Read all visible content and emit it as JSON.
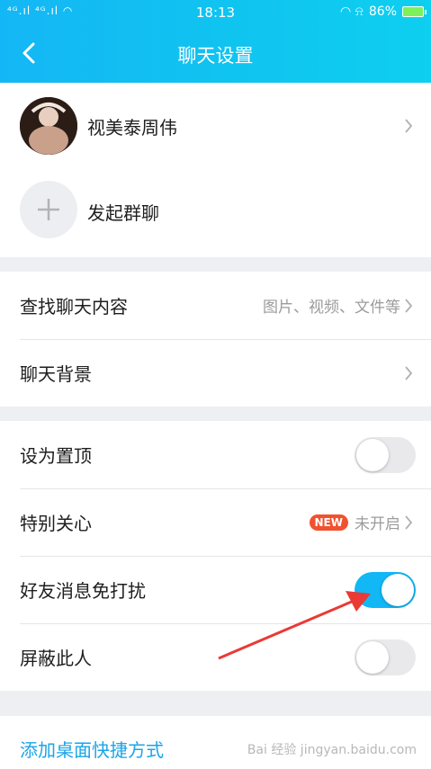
{
  "status_bar": {
    "signal_text": "⁴ᴳ.ıl ⁴ᴳ.ıl ◠",
    "time": "18:13",
    "icons_text": "◠ ⍾",
    "battery_percent": "86%"
  },
  "header": {
    "title": "聊天设置"
  },
  "members": [
    {
      "name": "视美泰周伟"
    },
    {
      "name": "发起群聊"
    }
  ],
  "search": {
    "label": "查找聊天内容",
    "hint": "图片、视频、文件等"
  },
  "background": {
    "label": "聊天背景"
  },
  "toggles": {
    "pin": {
      "label": "设为置顶",
      "on": false
    },
    "special": {
      "label": "特别关心",
      "badge": "NEW",
      "state": "未开启"
    },
    "mute": {
      "label": "好友消息免打扰",
      "on": true
    },
    "block": {
      "label": "屏蔽此人",
      "on": false
    }
  },
  "shortcut": {
    "label": "添加桌面快捷方式"
  },
  "watermark": "Bai 经验 jingyan.baidu.com",
  "colors": {
    "accent": "#12b7f5",
    "badge": "#f0522f",
    "annotation_arrow": "#ea3a36"
  }
}
